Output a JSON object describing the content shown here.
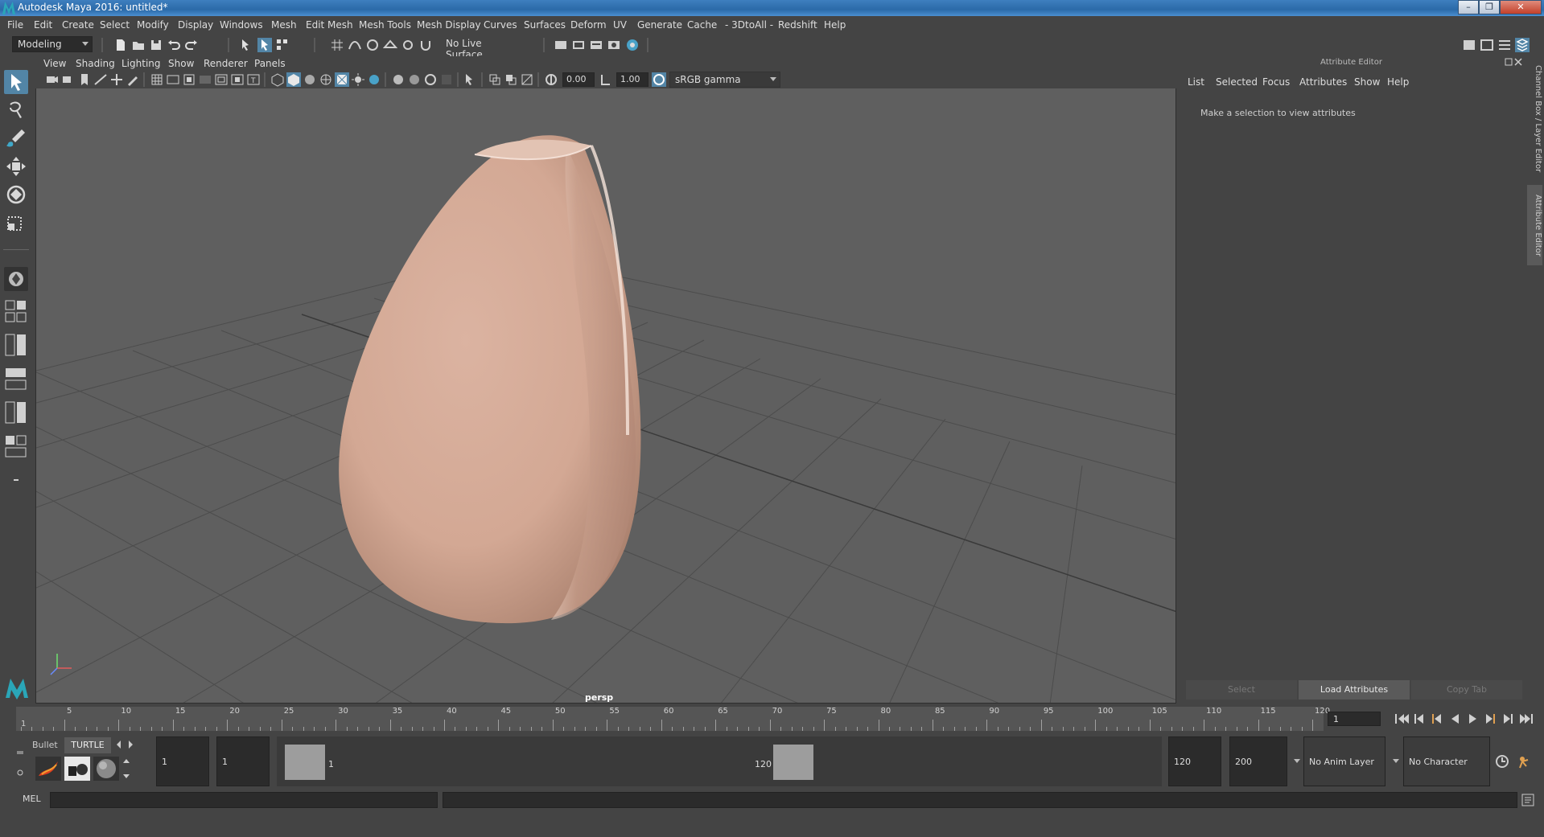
{
  "window": {
    "title": "Autodesk Maya 2016: untitled*"
  },
  "menubar": [
    "File",
    "Edit",
    "Create",
    "Select",
    "Modify",
    "Display",
    "Windows",
    "Mesh",
    "Edit Mesh",
    "Mesh Tools",
    "Mesh Display",
    "Curves",
    "Surfaces",
    "Deform",
    "UV",
    "Generate",
    "Cache",
    "- 3DtoAll -",
    "Redshift",
    "Help"
  ],
  "toolbar": {
    "mode": "Modeling",
    "live_surface": "No Live Surface"
  },
  "viewport": {
    "menu": [
      "View",
      "Shading",
      "Lighting",
      "Show",
      "Renderer",
      "Panels"
    ],
    "exposure": "0.00",
    "gamma": "1.00",
    "color_space": "sRGB gamma",
    "camera_label": "persp",
    "object_color": "#d4a996",
    "background_color": "#5f5f5f"
  },
  "attribute_editor": {
    "title": "Attribute Editor",
    "menu": [
      "List",
      "Selected",
      "Focus",
      "Attributes",
      "Show",
      "Help"
    ],
    "message": "Make a selection to view attributes",
    "buttons": {
      "select": "Select",
      "load": "Load Attributes",
      "copy_tab": "Copy Tab"
    }
  },
  "side_tabs": {
    "channel_box": "Channel Box / Layer Editor",
    "attribute_editor": "Attribute Editor"
  },
  "timeline": {
    "ticks": [
      "5",
      "10",
      "15",
      "20",
      "25",
      "30",
      "35",
      "40",
      "45",
      "50",
      "55",
      "60",
      "65",
      "70",
      "75",
      "80",
      "85",
      "90",
      "95",
      "100",
      "105",
      "110",
      "115",
      "120"
    ],
    "start_marker": "1",
    "current_frame": "1"
  },
  "shelf": {
    "tab_bullet": "Bullet",
    "tab_turtle": "TURTLE"
  },
  "range": {
    "start": "1",
    "playback_start": "1",
    "slider_start": "1",
    "slider_end": "120",
    "playback_end": "120",
    "end": "200",
    "anim_layer": "No Anim Layer",
    "character_set": "No Character Set"
  },
  "command_line": {
    "label": "MEL"
  }
}
